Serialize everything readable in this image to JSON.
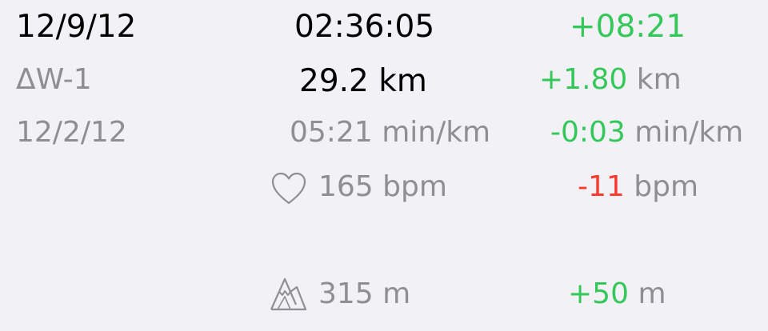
{
  "left": {
    "current_date": "12/9/12",
    "week_label": "ΔW-1",
    "previous_date": "12/2/12"
  },
  "middle": {
    "duration": "02:36:05",
    "distance": "29.2 km",
    "pace": "05:21 min/km",
    "heart_rate": "165 bpm",
    "elevation": "315 m",
    "heart_icon": "heart-outline-icon",
    "elevation_icon": "mountain-icon"
  },
  "deltas": {
    "duration": "+08:21",
    "distance_value": "+1.80",
    "distance_unit": "km",
    "pace_value": "-0:03",
    "pace_unit": "min/km",
    "heart_rate_value": "-11",
    "heart_rate_unit": "bpm",
    "elevation_value": "+50",
    "elevation_unit": "m"
  },
  "colors": {
    "background": "#f1f1f6",
    "primary_text": "#000000",
    "secondary_text": "#8e8e93",
    "positive": "#34c759",
    "negative": "#ff3b30"
  }
}
